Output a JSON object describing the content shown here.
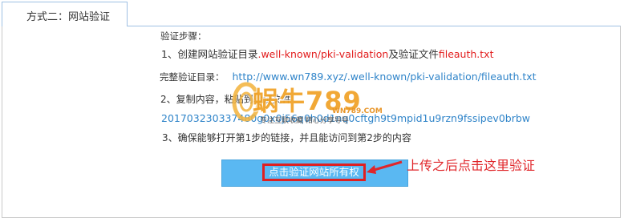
{
  "tab": {
    "label": "方式二：网站验证"
  },
  "instructions": {
    "title": "验证步骤：",
    "step1": {
      "prefix": "1、创建网站验证目录",
      "dir": ".well-known/pki-validation",
      "middle": "及验证文件",
      "file": "fileauth.txt"
    },
    "full_dir": {
      "label": "完整验证目录：",
      "url": "http://www.wn789.xyz/.well-known/pki-validation/fileauth.txt"
    },
    "step2": {
      "prefix": "2、复制内容，粘贴到验证文件",
      "tail": ""
    },
    "code": "201703230337480g0x0j56q0h0d1nq0cftgh9t9mpid1u9rzn9fssipev0brbw",
    "step3": "3、确保能够打开第1步的链接，并且能访问到第2步的内容"
  },
  "button": {
    "label": "点击验证网站所有权"
  },
  "annotation": {
    "text": "上传之后点击这里验证"
  },
  "watermark": {
    "main": "蜗牛789",
    "domain": "WN789.COM",
    "slogan": "专注互联收藏  精心分享导导"
  },
  "colors": {
    "accent_red": "#e21d1d",
    "link_blue": "#2f84c9",
    "button_blue": "#5ab8f2",
    "tab_border": "#9fc0e3"
  }
}
